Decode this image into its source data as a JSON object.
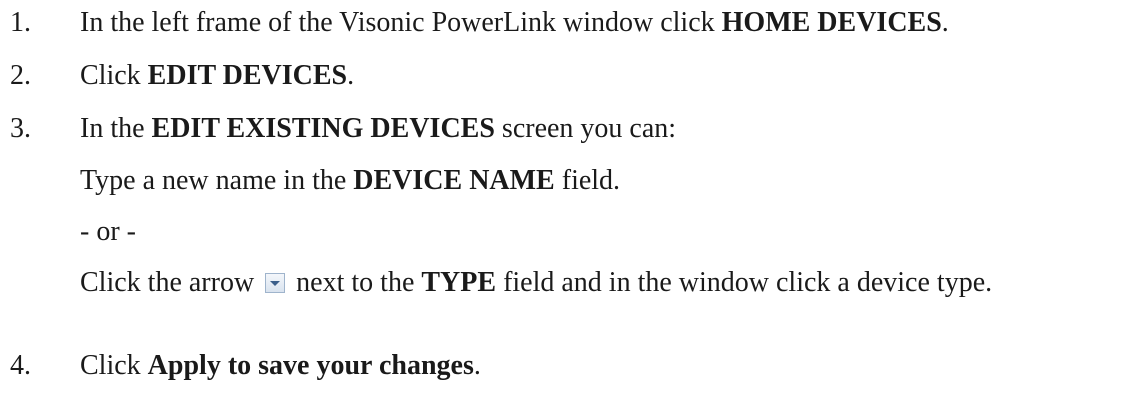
{
  "steps": [
    {
      "number": "1.",
      "parts": [
        "In the left frame of the Visonic PowerLink window click ",
        "HOME DEVICES",
        "."
      ]
    },
    {
      "number": "2.",
      "parts": [
        "Click ",
        "EDIT DEVICES",
        "."
      ]
    },
    {
      "number": "3.",
      "parts": [
        "In the ",
        "EDIT EXISTING DEVICES",
        " screen you can:"
      ],
      "sub_name": {
        "parts": [
          "Type a new name in the ",
          "DEVICE NAME",
          " field."
        ]
      },
      "separator": "- or -",
      "sub_type": {
        "before_icon": "Click the arrow",
        "icon": "dropdown-arrow-icon",
        "after_icon": " next to the ",
        "bold": "TYPE",
        "rest": " field and in the window click a device type."
      }
    },
    {
      "number": "4.",
      "parts": [
        "Click ",
        "Apply to save your changes",
        "."
      ]
    }
  ]
}
